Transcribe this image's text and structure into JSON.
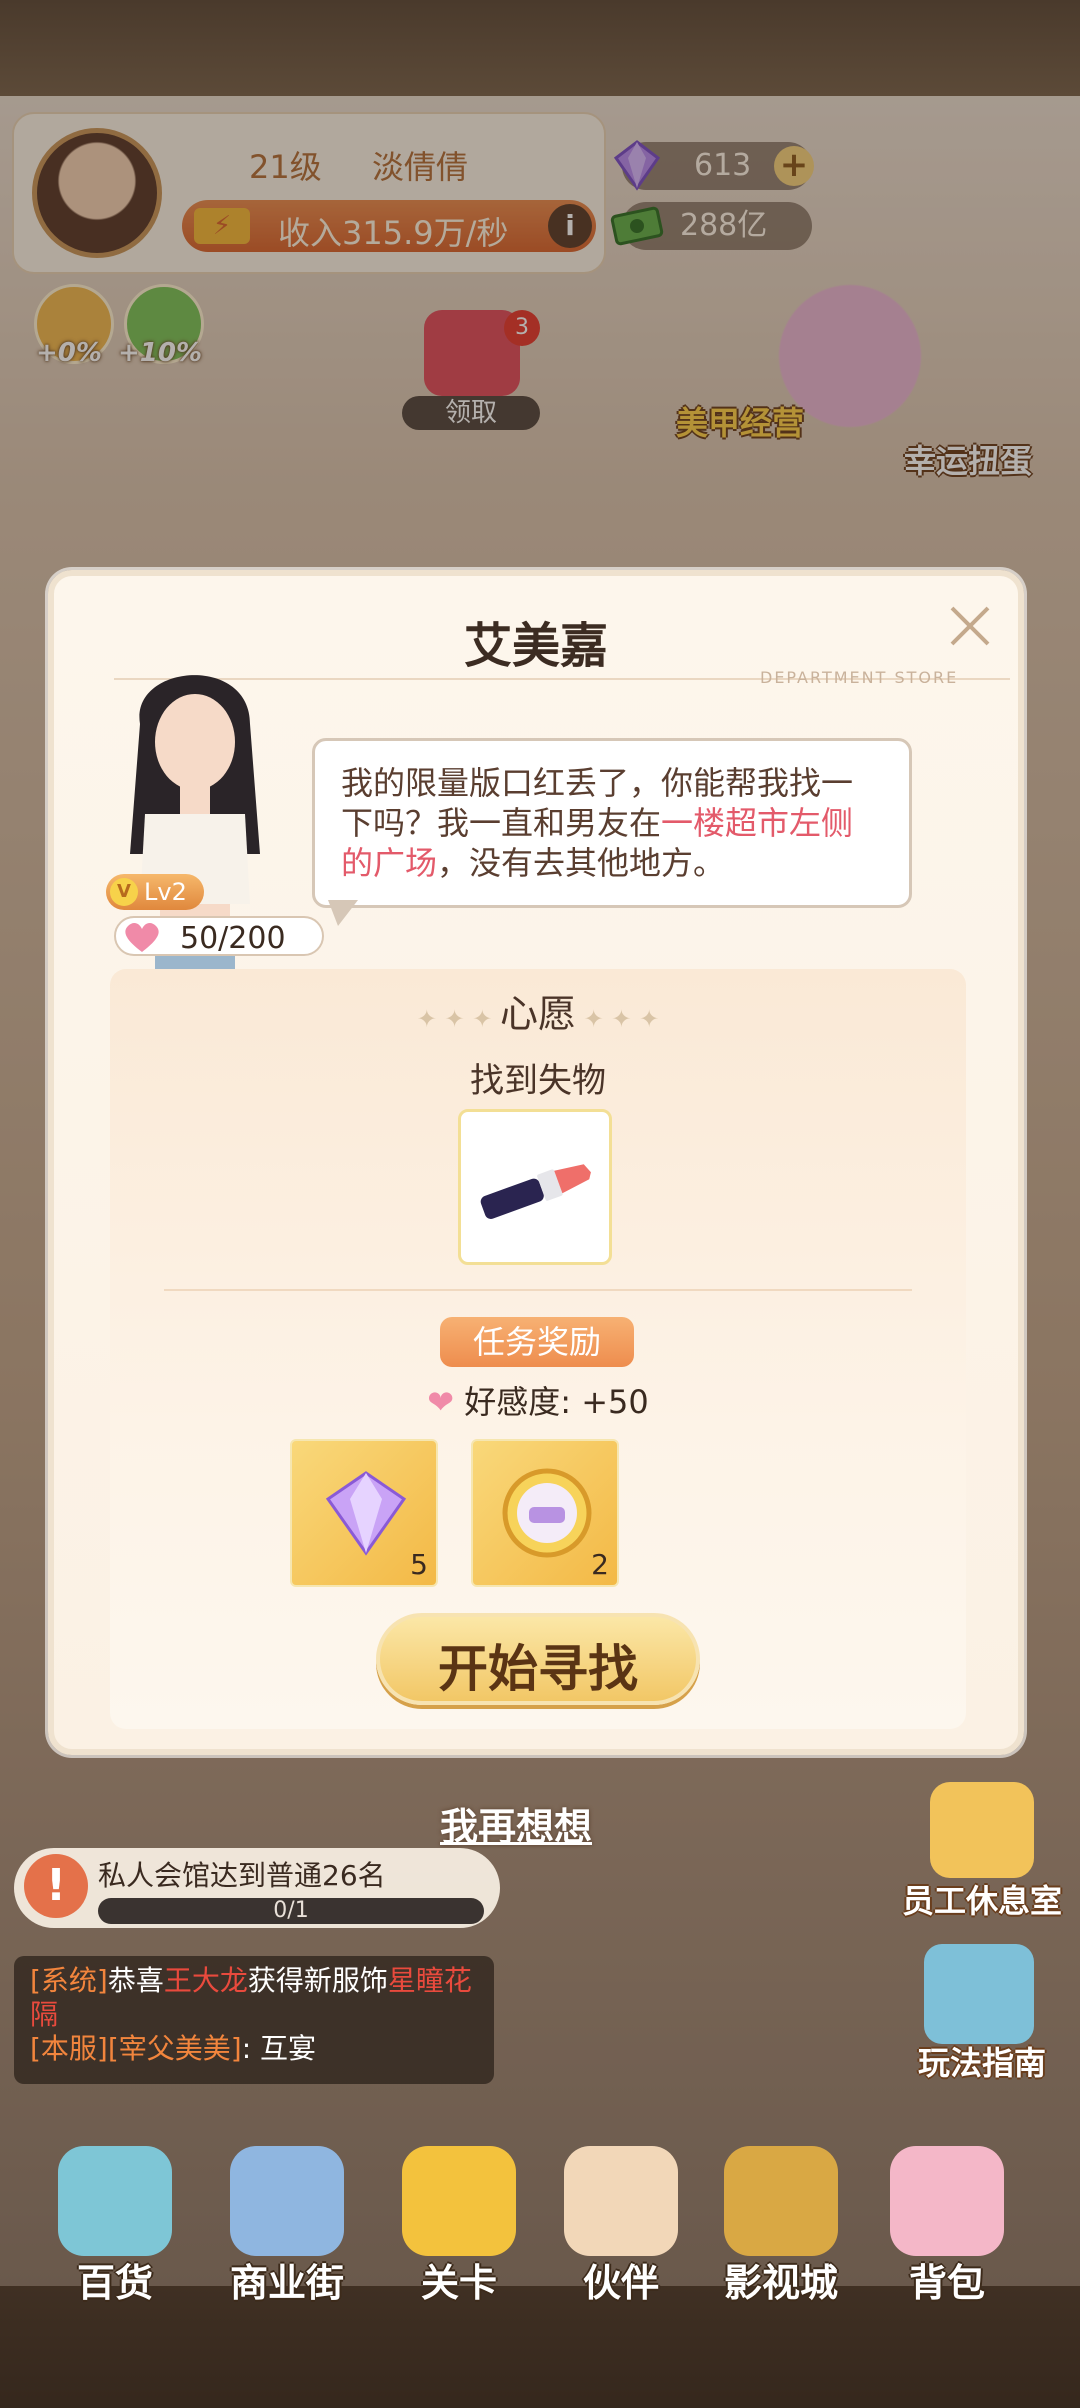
{
  "player": {
    "level": "21级",
    "name": "淡倩倩",
    "income": "收入315.9万/秒"
  },
  "resources": {
    "gems": "613",
    "cash": "288亿"
  },
  "boosts": [
    "+0%",
    "+10%"
  ],
  "top_features": {
    "claim_label": "领取",
    "claim_badge": "3",
    "nail_shop": "美甲经营",
    "lucky_gacha": "幸运扭蛋"
  },
  "dialog": {
    "npc_name": "艾美嘉",
    "store_label": "DEPARTMENT STORE",
    "npc_level": "Lv2",
    "affection": "50/200",
    "speech_part1": "我的限量版口红丢了，你能帮我找一下吗？我一直和男友在",
    "speech_highlight": "一楼超市左侧的广场",
    "speech_part2": "，没有去其他地方。",
    "wish_title": "心愿",
    "wish_task": "找到失物",
    "reward_tag": "任务奖励",
    "favor_reward": "好感度: +50",
    "rewards": [
      {
        "icon": "diamond-icon",
        "count": "5"
      },
      {
        "icon": "sofa-coin-icon",
        "count": "2"
      }
    ],
    "start_button": "开始寻找"
  },
  "think_again": "我再想想",
  "side_buttons": {
    "staff_lounge": "员工休息室",
    "play_guide": "玩法指南"
  },
  "quest": {
    "text": "私人会馆达到普通26名",
    "progress": "0/1",
    "progress_fraction": 0
  },
  "chat": {
    "line1_tag": "[系统]",
    "line1_pre": "恭喜",
    "line1_name": "王大龙",
    "line1_mid": "获得新服饰",
    "line1_item": "星瞳花隔",
    "line2_tag": "[本服]",
    "line2_name": "[宰父美美]",
    "line2_msg": ": 互宴"
  },
  "nav": [
    "百货",
    "商业街",
    "关卡",
    "伙伴",
    "影视城",
    "背包"
  ],
  "colors": {
    "accent": "#ee8d4e",
    "highlight": "#e35a6a",
    "gold": "#f2c766"
  }
}
